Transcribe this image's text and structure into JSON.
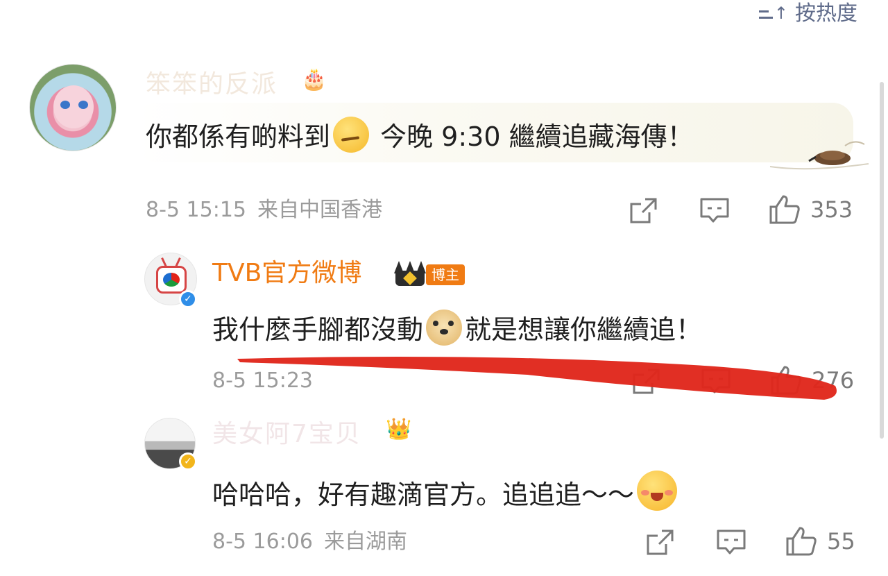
{
  "sort": {
    "label": "按热度"
  },
  "comments": [
    {
      "user": "笨笨的反派",
      "text_a": "你都係有啲料到",
      "text_b": " 今晚 9:30 繼續追藏海傳！",
      "time": "8-5 15:15",
      "location": "来自中国香港",
      "likes": "353"
    },
    {
      "user": "TVB官方微博",
      "badge": "博主",
      "text_a": "我什麼手腳都沒動",
      "text_b": "就是想讓你繼續追！",
      "time": "8-5 15:23",
      "likes": "276"
    },
    {
      "user": "美女阿7宝贝",
      "text_a": "哈哈哈，好有趣滴官方。追追追～～",
      "time": "8-5 16:06",
      "location": "来自湖南",
      "likes": "55"
    }
  ],
  "colors": {
    "accent_orange": "#f07b13",
    "verified_blue": "#2f8ee8",
    "verified_gold": "#f2b51b",
    "annotation_red": "#e0261b"
  }
}
